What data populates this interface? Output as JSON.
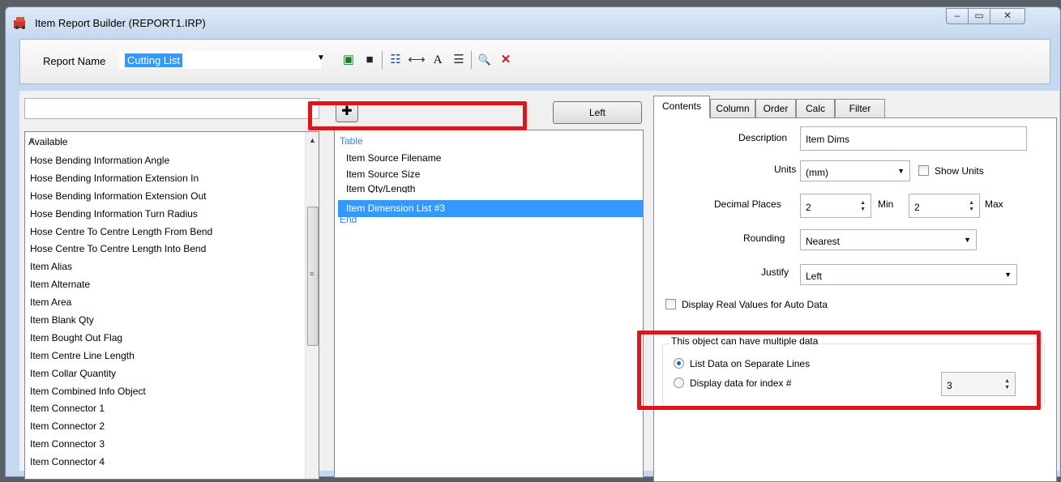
{
  "window": {
    "title": "Item Report Builder (REPORT1.IRP)",
    "controls": {
      "minimize": "–",
      "maximize": "▭",
      "close": "✕"
    }
  },
  "toolbar": {
    "report_name_label": "Report Name",
    "report_name_value": "Cutting List",
    "icons": [
      "new-report-icon",
      "save-icon",
      "select-fields-icon",
      "column-width-icon",
      "font-icon",
      "properties-icon",
      "print-preview-icon",
      "delete-icon"
    ],
    "icon_glyphs": {
      "new": "▣",
      "save": "■",
      "select": "☷",
      "width": "⟷",
      "font": "A",
      "properties": "☰",
      "preview": "🔍",
      "delete": "✕"
    }
  },
  "left_panel": {
    "filter_value": "",
    "list_header": "Available",
    "items": [
      "Hose Bending Information Angle",
      "Hose Bending Information Extension In",
      "Hose Bending Information Extension Out",
      "Hose Bending Information Turn Radius",
      "Hose Centre To Centre Length From Bend",
      "Hose Centre To Centre Length Into Bend",
      "Item Alias",
      "Item Alternate",
      "Item Area",
      "Item Blank Qty",
      "Item Bought Out Flag",
      "Item Centre Line Length",
      "Item Collar Quantity",
      "Item Combined Info Object",
      "Item Connector 1",
      "Item Connector 2",
      "Item Connector 3",
      "Item Connector 4"
    ]
  },
  "middle_panel": {
    "add_glyph": "✚",
    "align_button": "Left",
    "tree_root": "Table",
    "tree_items": [
      "Item Source Filename",
      "Item Source Size",
      "Item Qty/Length"
    ],
    "selected_item": "Item Dimension List #3",
    "tree_end": "End"
  },
  "right_panel": {
    "tabs": [
      "Contents",
      "Column",
      "Order",
      "Calc",
      "Filter"
    ],
    "active_tab": "Contents",
    "description_label": "Description",
    "description_value": "Item Dims",
    "units_label": "Units",
    "units_value": "(mm)",
    "show_units_label": "Show Units",
    "decimal_places_label": "Decimal Places",
    "decimal_min_value": "2",
    "min_label": "Min",
    "decimal_max_value": "2",
    "max_label": "Max",
    "rounding_label": "Rounding",
    "rounding_value": "Nearest",
    "justify_label": "Justify",
    "justify_value": "Left",
    "display_real_label": "Display Real Values for Auto Data",
    "group_label": "This object can have multiple data",
    "list_separate_label": "List Data on Separate Lines",
    "display_index_label": "Display data for index #",
    "index_value": "3"
  },
  "colors": {
    "selection": "#3399ff",
    "highlight_box": "#e0141b",
    "tree_header": "#3a7fd5"
  }
}
